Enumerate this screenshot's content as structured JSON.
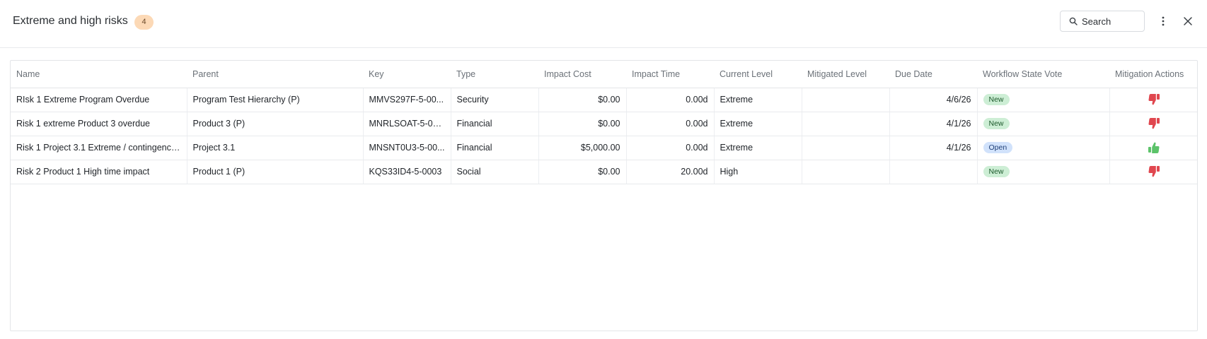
{
  "header": {
    "title": "Extreme and high risks",
    "count": "4",
    "search_placeholder": "Search"
  },
  "table": {
    "columns": [
      "Name",
      "Parent",
      "Key",
      "Type",
      "Impact Cost",
      "Impact Time",
      "Current Level",
      "Mitigated Level",
      "Due Date",
      "Workflow State Vote",
      "Mitigation Actions"
    ],
    "rows": [
      {
        "name": "RIsk 1 Extreme Program Overdue",
        "parent": "Program Test Hierarchy (P)",
        "key": "MMVS297F-5-00...",
        "type": "Security",
        "impact_cost": "$0.00",
        "impact_time": "0.00d",
        "current_level": "Extreme",
        "mitigated_level": "",
        "due_date": "4/6/26",
        "state": "New",
        "action": "thumbs-down-icon"
      },
      {
        "name": "Risk 1 extreme Product 3 overdue",
        "parent": "Product 3 (P)",
        "key": "MNRLSOAT-5-00...",
        "type": "Financial",
        "impact_cost": "$0.00",
        "impact_time": "0.00d",
        "current_level": "Extreme",
        "mitigated_level": "",
        "due_date": "4/1/26",
        "state": "New",
        "action": "thumbs-down-icon"
      },
      {
        "name": "Risk 1 Project 3.1 Extreme / contingency...",
        "parent": "Project 3.1",
        "key": "MNSNT0U3-5-00...",
        "type": "Financial",
        "impact_cost": "$5,000.00",
        "impact_time": "0.00d",
        "current_level": "Extreme",
        "mitigated_level": "",
        "due_date": "4/1/26",
        "state": "Open",
        "action": "thumbs-up-icon"
      },
      {
        "name": "Risk 2 Product 1 High time impact",
        "parent": "Product 1 (P)",
        "key": "KQS33ID4-5-0003",
        "type": "Social",
        "impact_cost": "$0.00",
        "impact_time": "20.00d",
        "current_level": "High",
        "mitigated_level": "",
        "due_date": "",
        "state": "New",
        "action": "thumbs-down-icon"
      }
    ]
  },
  "colors": {
    "badge_bg": "#fcd9b6",
    "state_new_bg": "#cdeed5",
    "state_open_bg": "#d1e2fb",
    "thumbs_down": "#e0474f",
    "thumbs_up": "#5cc36a"
  }
}
